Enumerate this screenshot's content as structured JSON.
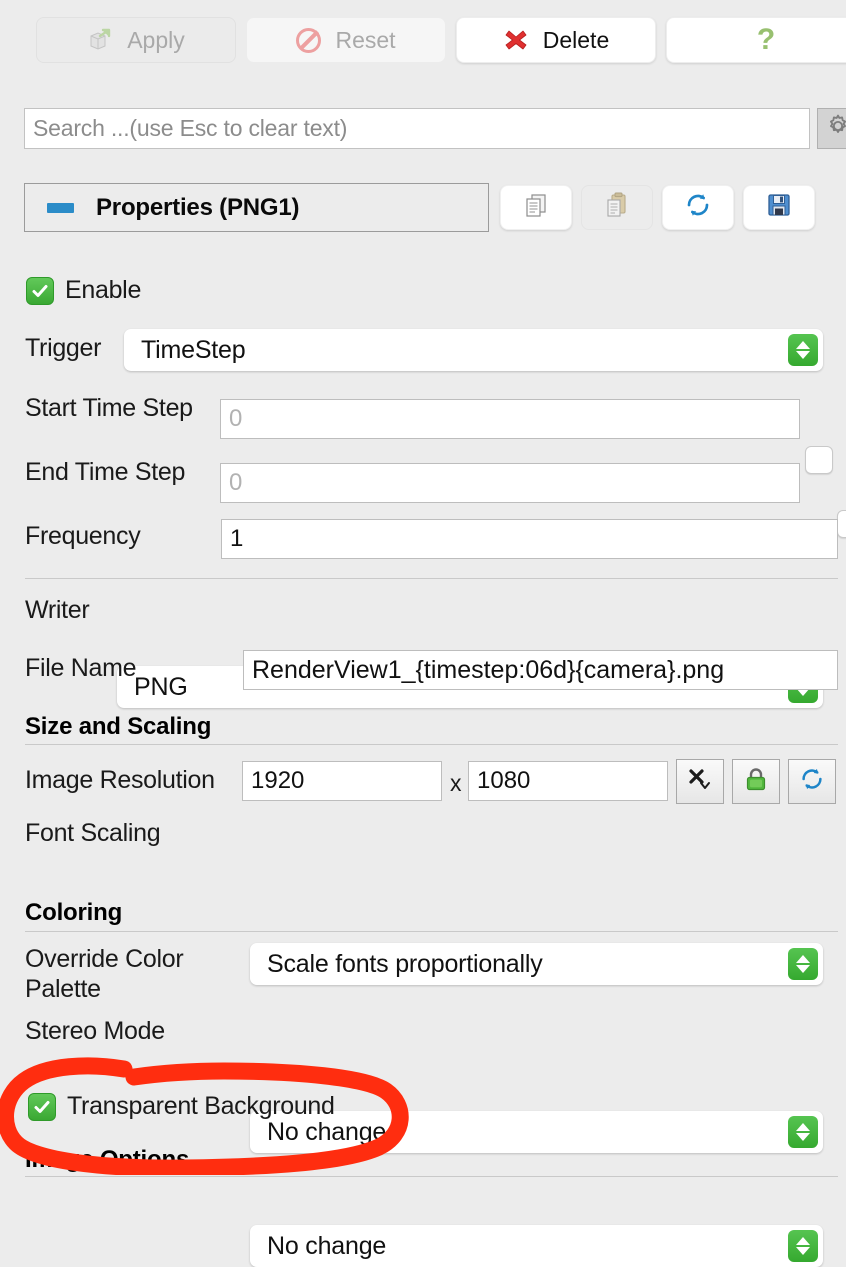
{
  "toolbar": {
    "apply_label": "Apply",
    "apply_icon": "cube-arrow-icon",
    "apply_disabled": true,
    "reset_label": "Reset",
    "reset_icon": "no-entry-icon",
    "reset_disabled": true,
    "delete_label": "Delete",
    "delete_icon": "red-x-icon",
    "help_label": "?",
    "help_icon": "question-mark-icon"
  },
  "search": {
    "placeholder": "Search ...(use Esc to clear text)",
    "value": "",
    "gear_icon": "gear-icon"
  },
  "panel": {
    "title": "Properties (PNG1)",
    "collapse_icon": "collapse-minus-icon",
    "buttons": [
      {
        "name": "copy",
        "icon": "copy-documents-icon",
        "disabled": false
      },
      {
        "name": "paste",
        "icon": "clipboard-paste-icon",
        "disabled": true
      },
      {
        "name": "restore-defaults",
        "icon": "refresh-circular-arrows-icon",
        "disabled": false
      },
      {
        "name": "save-defaults",
        "icon": "floppy-disk-save-icon",
        "disabled": false
      }
    ]
  },
  "properties": {
    "enable": {
      "label": "Enable",
      "checked": true
    },
    "trigger": {
      "label": "Trigger",
      "value": "TimeStep"
    },
    "start_time_step": {
      "label": "Start Time Step",
      "value": "0",
      "is_placeholder": true,
      "checkbox_checked": false
    },
    "end_time_step": {
      "label": "End Time Step",
      "value": "0",
      "is_placeholder": true,
      "checkbox_checked": false
    },
    "frequency": {
      "label": "Frequency",
      "value": "1",
      "is_placeholder": false
    },
    "writer": {
      "label": "Writer",
      "value": "PNG"
    },
    "file_name": {
      "label": "File Name",
      "value": "RenderView1_{timestep:06d}{camera}.png"
    }
  },
  "size_and_scaling": {
    "heading": "Size and Scaling",
    "image_resolution": {
      "label": "Image Resolution",
      "width": "1920",
      "separator": "x",
      "height": "1080",
      "buttons": [
        {
          "name": "scale-multiplier",
          "icon": "multiply-dropdown-icon"
        },
        {
          "name": "lock-aspect-ratio",
          "icon": "green-lock-icon"
        },
        {
          "name": "reset-resolution",
          "icon": "refresh-circular-arrows-icon"
        }
      ]
    },
    "font_scaling": {
      "label": "Font Scaling",
      "value": "Scale fonts proportionally"
    }
  },
  "coloring": {
    "heading": "Coloring",
    "override_color_palette": {
      "label": "Override Color\nPalette",
      "label_line1": "Override Color",
      "label_line2": "Palette",
      "value": "No change"
    },
    "stereo_mode": {
      "label": "Stereo Mode",
      "value": "No change"
    },
    "transparent_background": {
      "label": "Transparent Background",
      "checked": true
    }
  },
  "image_options": {
    "heading": "Image Options"
  },
  "annotation": {
    "type": "hand-drawn-ellipse",
    "color": "#FF2D0F",
    "target": "transparent-background-checkbox"
  },
  "colors": {
    "background": "#ececec",
    "accent_green": "#3aa833",
    "accent_blue": "#2b8cc8",
    "annotation_red": "#FF2D0F",
    "field_white": "#ffffff"
  }
}
